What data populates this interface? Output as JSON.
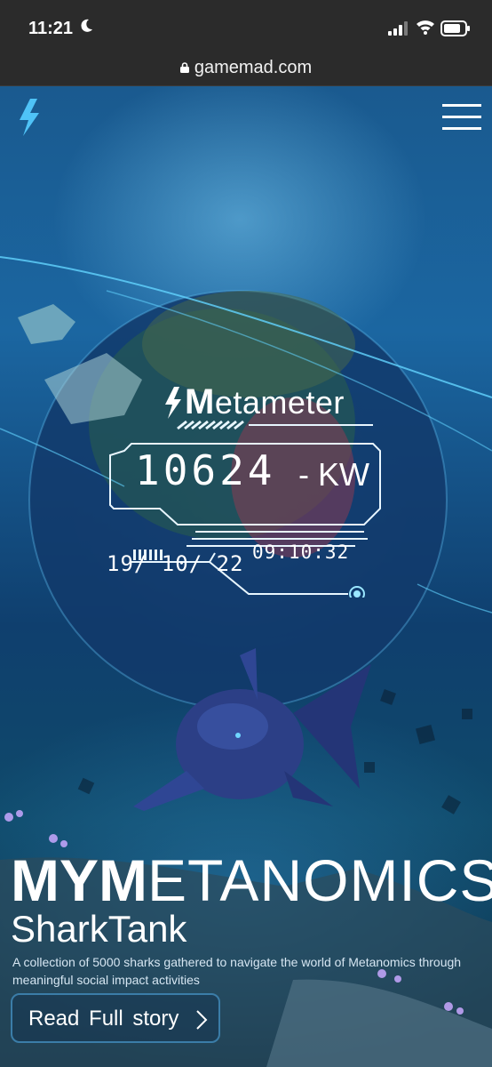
{
  "status_bar": {
    "time": "11:21"
  },
  "url_bar": {
    "domain": "gamemad.com"
  },
  "metameter": {
    "title_first": "M",
    "title_rest": "etameter",
    "value": "10624",
    "unit": "- KW",
    "date": "19/ 10/ 22",
    "time": "09:10:32"
  },
  "hero": {
    "headline_bold": "MYM",
    "headline_light": "ETANOMICS",
    "subtitle": "SharkTank",
    "description": "A collection of 5000 sharks gathered to navigate the world of Metanomics through meaningful social impact activities",
    "cta_label": "Read Full story"
  },
  "colors": {
    "accent": "#4fc3f7",
    "status_bar_bg": "#2b2b2b",
    "button_border": "#3b7da8"
  },
  "icons": {
    "logo": "lightning-bolt-icon",
    "menu": "hamburger-menu-icon",
    "cta": "chevron-right-icon"
  }
}
